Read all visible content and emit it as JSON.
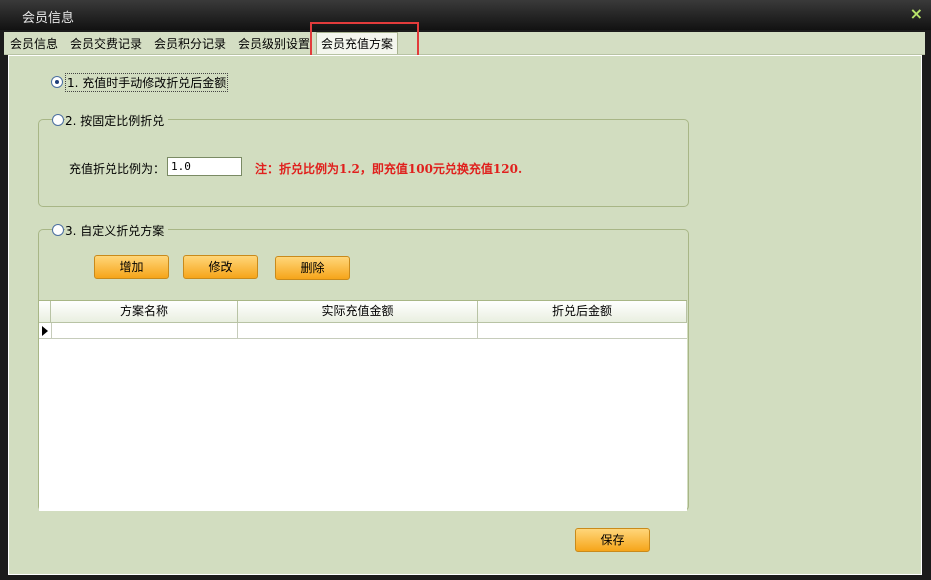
{
  "window": {
    "title": "会员信息",
    "close_glyph": "×"
  },
  "tabs": [
    {
      "label": "会员信息"
    },
    {
      "label": "会员交费记录"
    },
    {
      "label": "会员积分记录"
    },
    {
      "label": "会员级别设置"
    },
    {
      "label": "会员充值方案",
      "active": true
    }
  ],
  "options": {
    "opt1_label": "1. 充值时手动修改折兑后金额",
    "opt2_label": "2. 按固定比例折兑",
    "opt3_label": "3. 自定义折兑方案",
    "selected": 1
  },
  "ratio": {
    "label": "充值折兑比例为：",
    "value": "1.0",
    "note": "注：折兑比例为1.2，即充值100元兑换充值120."
  },
  "custom": {
    "add_label": "增加",
    "edit_label": "修改",
    "delete_label": "删除"
  },
  "table": {
    "columns": [
      "方案名称",
      "实际充值金额",
      "折兑后金额"
    ],
    "rows": []
  },
  "footer": {
    "save_label": "保存"
  },
  "colors": {
    "highlight": "#e23b3b",
    "accent_button": "#f6a51a",
    "note": "#e0201d"
  }
}
